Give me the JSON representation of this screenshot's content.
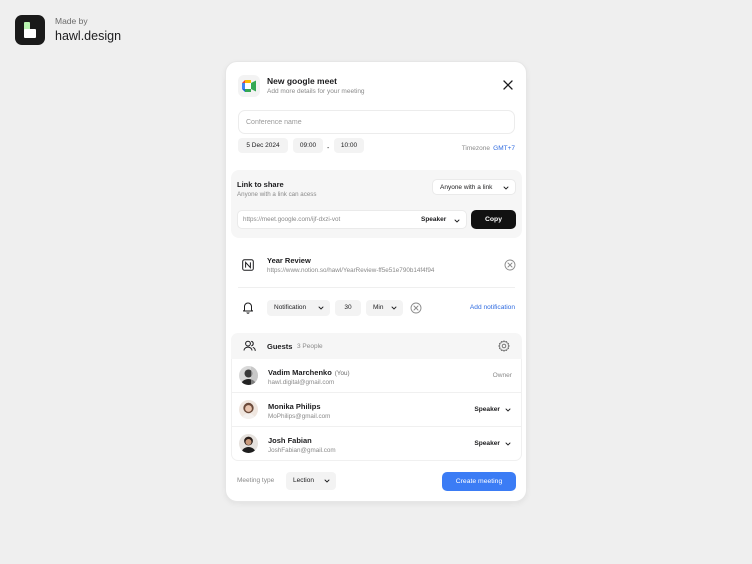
{
  "brand": {
    "made_by": "Made by",
    "name": "hawl.design"
  },
  "header": {
    "title": "New google meet",
    "subtitle": "Add more details for your meeting"
  },
  "conference": {
    "placeholder": "Conference name",
    "value": ""
  },
  "schedule": {
    "date": "5 Dec 2024",
    "start": "09:00",
    "separator": "-",
    "end": "10:00",
    "timezone_label": "Timezone",
    "timezone_value": "GMT+7"
  },
  "share": {
    "title": "Link to share",
    "subtitle": "Anyone with  a link can acess",
    "access": "Anyone with a link",
    "link": "https://meet.google.com/ijf-dxzi-vot",
    "role": "Speaker",
    "copy_label": "Copy"
  },
  "attachment": {
    "title": "Year Review",
    "url": "https://www.notion.so/hawl/YearReview-ff5e51e790b14f4f94"
  },
  "notification": {
    "type": "Notification",
    "amount": "30",
    "unit": "Min",
    "add_label": "Add notification"
  },
  "guests": {
    "title": "Guests",
    "count": "3 People",
    "list": [
      {
        "name": "Vadim Marchenko",
        "tag": "(You)",
        "email": "hawl.digital@gmail.com",
        "role": "Owner"
      },
      {
        "name": "Monika Philips",
        "tag": "",
        "email": "MoPhilips@gmail.com",
        "role": "Speaker"
      },
      {
        "name": "Josh Fabian",
        "tag": "",
        "email": "JoshFabian@gmail.com",
        "role": "Speaker"
      }
    ]
  },
  "footer": {
    "meeting_type_label": "Meeting type",
    "meeting_type": "Lection",
    "create_label": "Create meeting"
  },
  "colors": {
    "accent": "#3b7cf5",
    "link": "#2f6be0",
    "dark_button": "#111111"
  }
}
